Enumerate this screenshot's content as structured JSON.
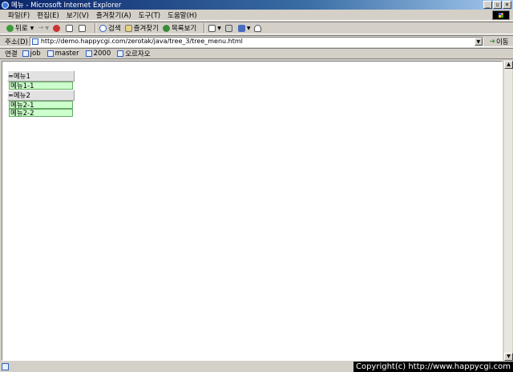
{
  "window": {
    "title": "메뉴 - Microsoft Internet Explorer",
    "controls": [
      "_",
      "▫",
      "×"
    ]
  },
  "menubar": [
    "파일(F)",
    "편집(E)",
    "보기(V)",
    "즐겨찾기(A)",
    "도구(T)",
    "도움말(H)"
  ],
  "toolbar": {
    "back": "뒤로",
    "forward": "→",
    "search": "검색",
    "favorites": "즐겨찾기",
    "history": "목록보기"
  },
  "address": {
    "label": "주소(D)",
    "url": "http://demo.happycgi.com/zerotak/java/tree_3/tree_menu.html",
    "go": "이동"
  },
  "links": {
    "label": "연결",
    "items": [
      "job",
      "master",
      "2000",
      "오르자오"
    ]
  },
  "tree": {
    "menu1": {
      "label": "메뉴1",
      "items": [
        "메뉴1-1"
      ]
    },
    "menu2": {
      "label": "메뉴2",
      "items": [
        "메뉴2-1",
        "메뉴2-2"
      ]
    }
  },
  "status": {
    "copyright": "Copyright(c) http://www.happycgi.com"
  },
  "colors": {
    "titlebar": "#0a246a",
    "submenu_bg": "#ccffcc",
    "chrome": "#d4d0c8"
  }
}
